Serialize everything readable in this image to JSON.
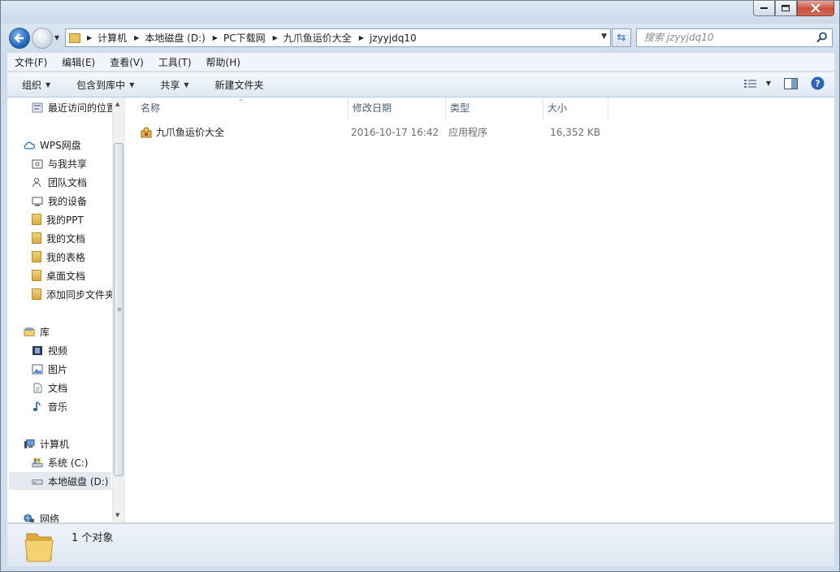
{
  "address": {
    "segments": [
      "计算机",
      "本地磁盘 (D:)",
      "PC下载网",
      "九爪鱼运价大全",
      "jzyyjdq10"
    ]
  },
  "search": {
    "placeholder": "搜索 jzyyjdq10"
  },
  "menu": [
    "文件(F)",
    "编辑(E)",
    "查看(V)",
    "工具(T)",
    "帮助(H)"
  ],
  "toolbar": {
    "organize": "组织",
    "include_library": "包含到库中",
    "share": "共享",
    "new_folder": "新建文件夹"
  },
  "sidebar": {
    "recent": "最近访问的位置",
    "wps": "WPS网盘",
    "wps_items": [
      "与我共享",
      "团队文档",
      "我的设备",
      "我的PPT",
      "我的文档",
      "我的表格",
      "桌面文档",
      "添加同步文件夹"
    ],
    "library": "库",
    "library_items": [
      "视频",
      "图片",
      "文档",
      "音乐"
    ],
    "computer": "计算机",
    "drives": [
      "系统 (C:)",
      "本地磁盘 (D:)"
    ],
    "network": "网络"
  },
  "columns": {
    "name": "名称",
    "modified": "修改日期",
    "type": "类型",
    "size": "大小"
  },
  "files": [
    {
      "name": "九爪鱼运价大全",
      "modified": "2016-10-17 16:42",
      "type": "应用程序",
      "size": "16,352 KB"
    }
  ],
  "status": {
    "count_text": "1 个对象"
  }
}
